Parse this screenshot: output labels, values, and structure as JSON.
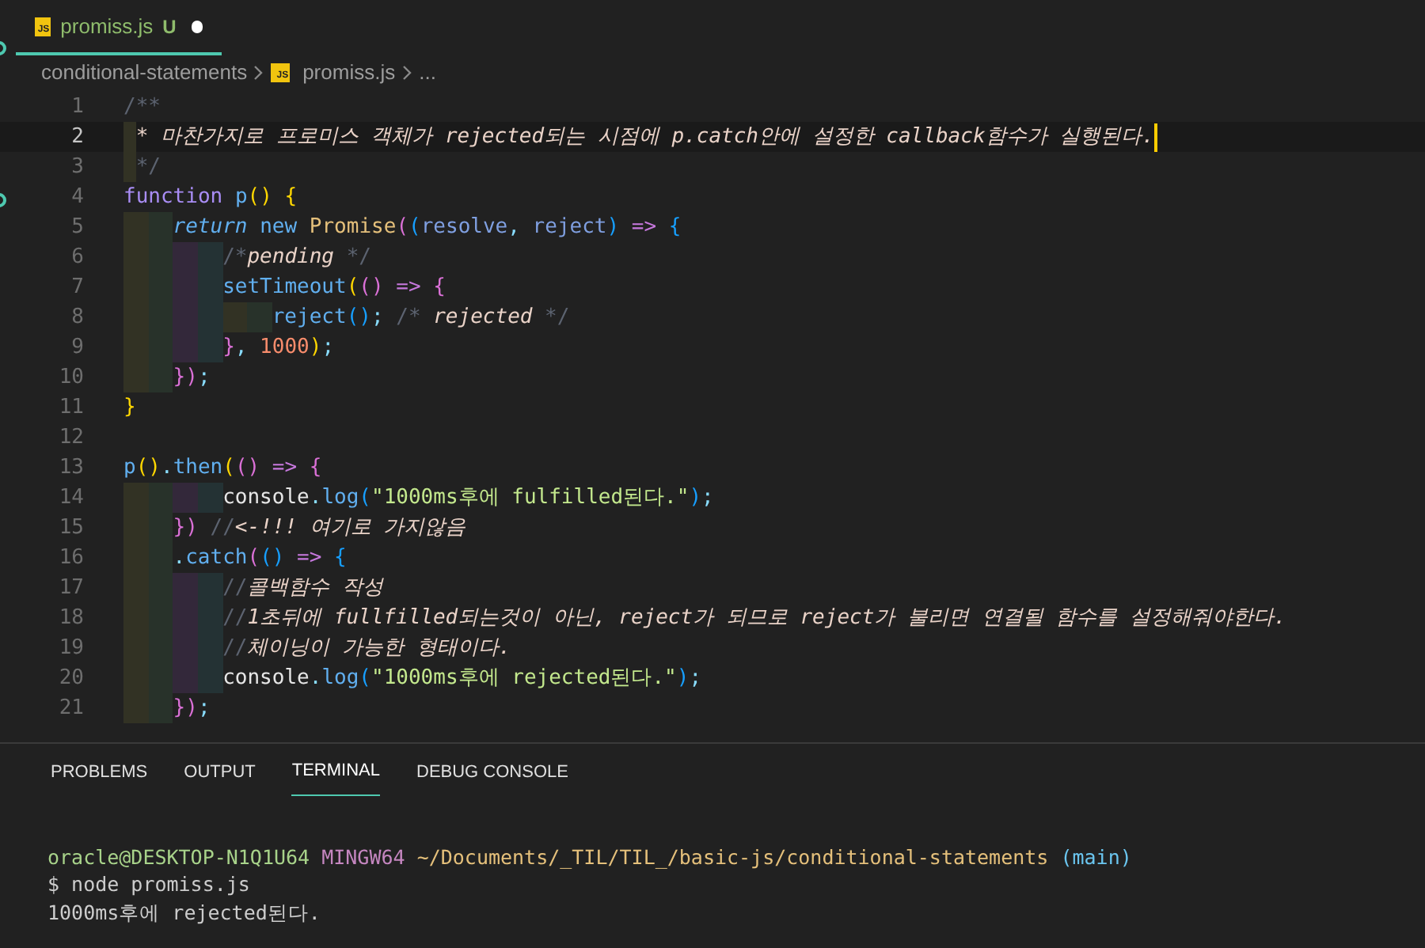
{
  "tab": {
    "icon_label": "JS",
    "title": "promiss.js",
    "badge": "U",
    "modified": true,
    "selected": true
  },
  "breadcrumb": [
    {
      "label": "conditional-statements",
      "kind": "folder"
    },
    {
      "label": "promiss.js",
      "kind": "file",
      "icon_label": "JS"
    },
    {
      "label": "...",
      "kind": "more"
    }
  ],
  "editor": {
    "lines": [
      {
        "number": "1",
        "current": false,
        "tokens": [
          {
            "t": "/**",
            "kind": "cdelim"
          }
        ]
      },
      {
        "number": "2",
        "current": true,
        "cursor": true,
        "guides": [
          {
            "color": "#323224",
            "kind": "narrow"
          }
        ],
        "tokens": [
          {
            "t": "* 마찬가지로 프로미스 객체가 rejected되는 시점에 p.catch안에 설정한 callback함수가 실행된다.",
            "kind": "ctext"
          }
        ]
      },
      {
        "number": "3",
        "current": false,
        "guides": [
          {
            "color": "#323224",
            "kind": "narrow"
          }
        ],
        "tokens": [
          {
            "t": "*/",
            "kind": "cdelim"
          }
        ]
      },
      {
        "number": "4",
        "current": false,
        "tokens": [
          {
            "t": "function ",
            "kind": "storage"
          },
          {
            "t": "p",
            "kind": "fn"
          },
          {
            "t": "() {",
            "kind": "b1"
          }
        ]
      },
      {
        "number": "5",
        "current": false,
        "guides": [
          {
            "color": "#323224",
            "kind": "wide"
          },
          {
            "color": "#28322a",
            "kind": "wide"
          }
        ],
        "tokens": [
          {
            "t": "return ",
            "kind": "ctl"
          },
          {
            "t": "new ",
            "kind": "fn"
          },
          {
            "t": "Promise",
            "kind": "cls"
          },
          {
            "t": "(",
            "kind": "b2"
          },
          {
            "t": "(",
            "kind": "b3"
          },
          {
            "t": "resolve",
            "kind": "param"
          },
          {
            "t": ", ",
            "kind": "p"
          },
          {
            "t": "reject",
            "kind": "param"
          },
          {
            "t": ")",
            "kind": "b3"
          },
          {
            "t": " => ",
            "kind": "op"
          },
          {
            "t": "{",
            "kind": "b3"
          }
        ]
      },
      {
        "number": "6",
        "current": false,
        "guides": [
          {
            "color": "#323224",
            "kind": "wide"
          },
          {
            "color": "#28322a",
            "kind": "wide"
          },
          {
            "color": "#33283a",
            "kind": "wide"
          },
          {
            "color": "#243234",
            "kind": "wide"
          }
        ],
        "tokens": [
          {
            "t": "/*",
            "kind": "cdelim"
          },
          {
            "t": "pending",
            "kind": "ctext"
          },
          {
            "t": " */",
            "kind": "cdelim"
          }
        ]
      },
      {
        "number": "7",
        "current": false,
        "guides": [
          {
            "color": "#323224",
            "kind": "wide"
          },
          {
            "color": "#28322a",
            "kind": "wide"
          },
          {
            "color": "#33283a",
            "kind": "wide"
          },
          {
            "color": "#243234",
            "kind": "wide"
          }
        ],
        "tokens": [
          {
            "t": "setTimeout",
            "kind": "fn"
          },
          {
            "t": "(",
            "kind": "b1"
          },
          {
            "t": "()",
            "kind": "b2"
          },
          {
            "t": " => ",
            "kind": "op"
          },
          {
            "t": "{",
            "kind": "b2"
          }
        ]
      },
      {
        "number": "8",
        "current": false,
        "guides": [
          {
            "color": "#323224",
            "kind": "wide"
          },
          {
            "color": "#28322a",
            "kind": "wide"
          },
          {
            "color": "#33283a",
            "kind": "wide"
          },
          {
            "color": "#243234",
            "kind": "wide"
          },
          {
            "color": "#323224",
            "kind": "wide"
          },
          {
            "color": "#28322a",
            "kind": "wide"
          }
        ],
        "tokens": [
          {
            "t": "reject",
            "kind": "fn"
          },
          {
            "t": "()",
            "kind": "b3"
          },
          {
            "t": "; ",
            "kind": "p"
          },
          {
            "t": "/* ",
            "kind": "cdelim"
          },
          {
            "t": "rejected",
            "kind": "ctext"
          },
          {
            "t": " */",
            "kind": "cdelim"
          }
        ]
      },
      {
        "number": "9",
        "current": false,
        "guides": [
          {
            "color": "#323224",
            "kind": "wide"
          },
          {
            "color": "#28322a",
            "kind": "wide"
          },
          {
            "color": "#33283a",
            "kind": "wide"
          },
          {
            "color": "#243234",
            "kind": "wide"
          }
        ],
        "tokens": [
          {
            "t": "}",
            "kind": "b2"
          },
          {
            "t": ", ",
            "kind": "p"
          },
          {
            "t": "1000",
            "kind": "num"
          },
          {
            "t": ")",
            "kind": "b1"
          },
          {
            "t": ";",
            "kind": "p"
          }
        ]
      },
      {
        "number": "10",
        "current": false,
        "guides": [
          {
            "color": "#323224",
            "kind": "wide"
          },
          {
            "color": "#28322a",
            "kind": "wide"
          }
        ],
        "tokens": [
          {
            "t": "})",
            "kind": "b2"
          },
          {
            "t": ";",
            "kind": "p"
          }
        ]
      },
      {
        "number": "11",
        "current": false,
        "tokens": [
          {
            "t": "}",
            "kind": "b1"
          }
        ]
      },
      {
        "number": "12",
        "current": false
      },
      {
        "number": "13",
        "current": false,
        "tokens": [
          {
            "t": "p",
            "kind": "fn"
          },
          {
            "t": "()",
            "kind": "b1"
          },
          {
            "t": ".",
            "kind": "p"
          },
          {
            "t": "then",
            "kind": "fn"
          },
          {
            "t": "(",
            "kind": "b1"
          },
          {
            "t": "()",
            "kind": "b2"
          },
          {
            "t": " => ",
            "kind": "op"
          },
          {
            "t": "{",
            "kind": "b2"
          }
        ]
      },
      {
        "number": "14",
        "current": false,
        "guides": [
          {
            "color": "#323224",
            "kind": "wide"
          },
          {
            "color": "#28322a",
            "kind": "wide"
          },
          {
            "color": "#33283a",
            "kind": "wide"
          },
          {
            "color": "#243234",
            "kind": "wide"
          }
        ],
        "tokens": [
          {
            "t": "console",
            "kind": "plain"
          },
          {
            "t": ".",
            "kind": "p"
          },
          {
            "t": "log",
            "kind": "fn"
          },
          {
            "t": "(",
            "kind": "b3"
          },
          {
            "t": "\"1000ms후에 fulfilled된다.\"",
            "kind": "str"
          },
          {
            "t": ")",
            "kind": "b3"
          },
          {
            "t": ";",
            "kind": "p"
          }
        ]
      },
      {
        "number": "15",
        "current": false,
        "guides": [
          {
            "color": "#323224",
            "kind": "wide"
          },
          {
            "color": "#28322a",
            "kind": "wide"
          }
        ],
        "tokens": [
          {
            "t": "})",
            "kind": "b2"
          },
          {
            "t": " //",
            "kind": "cdelim"
          },
          {
            "t": "<-!!! 여기로 가지않음",
            "kind": "ctext"
          }
        ]
      },
      {
        "number": "16",
        "current": false,
        "guides": [
          {
            "color": "#323224",
            "kind": "wide"
          },
          {
            "color": "#28322a",
            "kind": "wide"
          }
        ],
        "tokens": [
          {
            "t": ".",
            "kind": "p"
          },
          {
            "t": "catch",
            "kind": "fn"
          },
          {
            "t": "(",
            "kind": "b2"
          },
          {
            "t": "()",
            "kind": "b3"
          },
          {
            "t": " => ",
            "kind": "op"
          },
          {
            "t": "{",
            "kind": "b3"
          }
        ]
      },
      {
        "number": "17",
        "current": false,
        "guides": [
          {
            "color": "#323224",
            "kind": "wide"
          },
          {
            "color": "#28322a",
            "kind": "wide"
          },
          {
            "color": "#33283a",
            "kind": "wide"
          },
          {
            "color": "#243234",
            "kind": "wide"
          }
        ],
        "tokens": [
          {
            "t": "//",
            "kind": "cdelim"
          },
          {
            "t": "콜백함수 작성",
            "kind": "ctext"
          }
        ]
      },
      {
        "number": "18",
        "current": false,
        "guides": [
          {
            "color": "#323224",
            "kind": "wide"
          },
          {
            "color": "#28322a",
            "kind": "wide"
          },
          {
            "color": "#33283a",
            "kind": "wide"
          },
          {
            "color": "#243234",
            "kind": "wide"
          }
        ],
        "tokens": [
          {
            "t": "//",
            "kind": "cdelim"
          },
          {
            "t": "1초뒤에 fullfilled되는것이 아닌, reject가 되므로 reject가 불리면 연결될 함수를 설정해줘야한다.",
            "kind": "ctext"
          }
        ]
      },
      {
        "number": "19",
        "current": false,
        "guides": [
          {
            "color": "#323224",
            "kind": "wide"
          },
          {
            "color": "#28322a",
            "kind": "wide"
          },
          {
            "color": "#33283a",
            "kind": "wide"
          },
          {
            "color": "#243234",
            "kind": "wide"
          }
        ],
        "tokens": [
          {
            "t": "//",
            "kind": "cdelim"
          },
          {
            "t": "체이닝이 가능한 형태이다.",
            "kind": "ctext"
          }
        ]
      },
      {
        "number": "20",
        "current": false,
        "guides": [
          {
            "color": "#323224",
            "kind": "wide"
          },
          {
            "color": "#28322a",
            "kind": "wide"
          },
          {
            "color": "#33283a",
            "kind": "wide"
          },
          {
            "color": "#243234",
            "kind": "wide"
          }
        ],
        "tokens": [
          {
            "t": "console",
            "kind": "plain"
          },
          {
            "t": ".",
            "kind": "p"
          },
          {
            "t": "log",
            "kind": "fn"
          },
          {
            "t": "(",
            "kind": "b3"
          },
          {
            "t": "\"1000ms후에 rejected된다.\"",
            "kind": "str"
          },
          {
            "t": ")",
            "kind": "b3"
          },
          {
            "t": ";",
            "kind": "p"
          }
        ]
      },
      {
        "number": "21",
        "current": false,
        "guides": [
          {
            "color": "#323224",
            "kind": "wide"
          },
          {
            "color": "#28322a",
            "kind": "wide"
          }
        ],
        "tokens": [
          {
            "t": "})",
            "kind": "b2"
          },
          {
            "t": ";",
            "kind": "p"
          }
        ]
      }
    ]
  },
  "panel_tabs": [
    {
      "label": "PROBLEMS",
      "selected": false
    },
    {
      "label": "OUTPUT",
      "selected": false
    },
    {
      "label": "TERMINAL",
      "selected": true
    },
    {
      "label": "DEBUG CONSOLE",
      "selected": false
    }
  ],
  "terminal": {
    "lines": [
      {
        "parts": [
          {
            "t": "oracle@DESKTOP-N1Q1U64",
            "kind": "user"
          },
          {
            "t": "MINGW64",
            "kind": "host"
          },
          {
            "t": "~/Documents/_TIL/TIL_/basic-js/conditional-statements",
            "kind": "path"
          },
          {
            "t": "(main)",
            "kind": "branch"
          }
        ]
      },
      {
        "parts": [
          {
            "t": "$ node promiss.js",
            "kind": "plain"
          }
        ]
      },
      {
        "parts": [
          {
            "t": "1000ms후에 rejected된다.",
            "kind": "plain"
          }
        ]
      }
    ]
  }
}
